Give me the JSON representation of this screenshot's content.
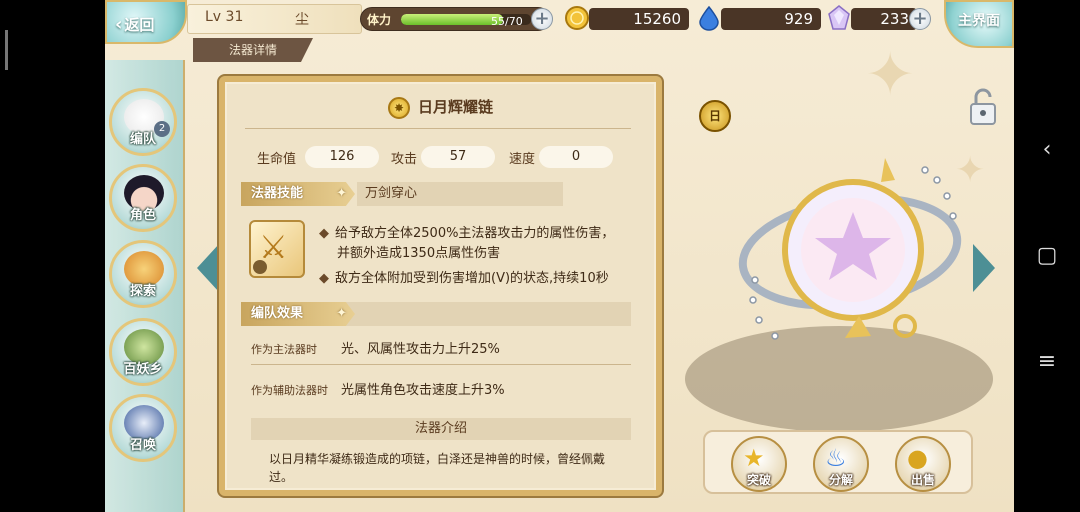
{
  "topbar": {
    "back_label": "返回",
    "level": "Lv 31",
    "player_name": "尘",
    "stamina_label": "体力",
    "stamina_value": "55/70",
    "stamina_fraction": 0.786,
    "gold": "15260",
    "water": "929",
    "crystal": "233",
    "main_label": "主界面",
    "sub_tab": "法器详情"
  },
  "nav": {
    "items": [
      {
        "label": "编队",
        "badge": "2"
      },
      {
        "label": "角色"
      },
      {
        "label": "探索"
      },
      {
        "label": "百妖乡"
      },
      {
        "label": "召唤"
      }
    ]
  },
  "artifact": {
    "name": "日月辉耀链",
    "rank": "日",
    "stats": {
      "hp_label": "生命值",
      "hp": "126",
      "atk_label": "攻击",
      "atk": "57",
      "spd_label": "速度",
      "spd": "0"
    },
    "skill_tag": "法器技能",
    "skill_name": "万剑穿心",
    "skill_lines": [
      "给予敌方全体2500%主法器攻击力的属性伤害，",
      "并额外造成1350点属性伤害",
      "敌方全体附加受到伤害增加(V)的状态,持续10秒"
    ],
    "team_tag": "编队效果",
    "main_effect_label": "作为主法器时",
    "main_effect": "光、风属性攻击力上升25%",
    "sub_effect_label": "作为辅助法器时",
    "sub_effect": "光属性角色攻击速度上升3%",
    "intro_title": "法器介绍",
    "intro_text": "以日月精华凝练锻造成的项链，白泽还是神兽的时候，曾经佩戴过。"
  },
  "actions": {
    "breakthrough": "突破",
    "decompose": "分解",
    "sell": "出售"
  },
  "colors": {
    "panel_border": "#d9b46a",
    "panel_bg": "#efe3c8",
    "accent_teal": "#8bd0cf",
    "stamina_green": "#6cbf2a"
  }
}
